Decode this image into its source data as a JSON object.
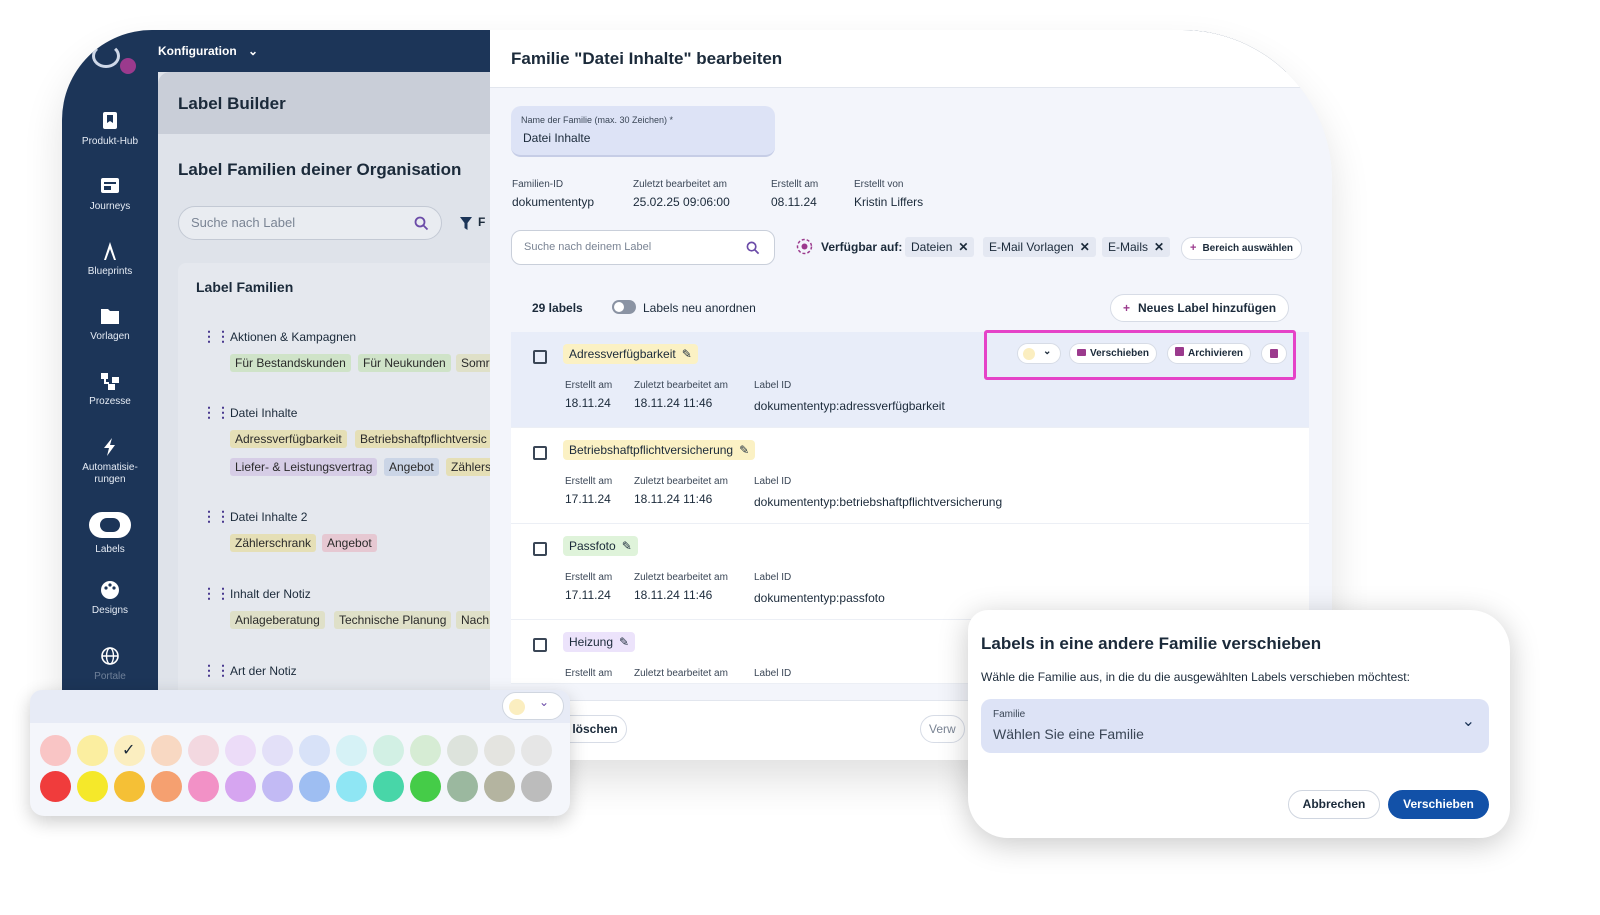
{
  "topbar": {
    "section": "Konfiguration"
  },
  "nav": {
    "items": [
      {
        "label": "Produkt-Hub",
        "icon": "bookmark-icon"
      },
      {
        "label": "Journeys",
        "icon": "journeys-icon"
      },
      {
        "label": "Blueprints",
        "icon": "compass-icon"
      },
      {
        "label": "Vorlagen",
        "icon": "folder-icon"
      },
      {
        "label": "Prozesse",
        "icon": "process-icon"
      },
      {
        "label": "Automatisie-",
        "label2": "rungen",
        "icon": "lightning-icon"
      },
      {
        "label": "Labels",
        "icon": "label-icon"
      },
      {
        "label": "Designs",
        "icon": "palette-icon"
      },
      {
        "label": "Portale",
        "icon": "globe-icon"
      }
    ]
  },
  "left": {
    "page_title": "Label Builder",
    "section_title": "Label Familien deiner Organisation",
    "search_placeholder": "Suche nach Label",
    "filter_label": "F",
    "families_header": "Label Familien",
    "families": [
      {
        "name": "Aktionen & Kampagnen",
        "chips": [
          "Für Bestandskunden",
          "Für Neukunden",
          "Somr"
        ]
      },
      {
        "name": "Datei Inhalte",
        "chips": [
          "Adressverfügbarkeit",
          "Betriebshaftpflichtversic",
          "Liefer- & Leistungsvertrag",
          "Angebot",
          "Zählers"
        ]
      },
      {
        "name": "Datei Inhalte 2",
        "chips": [
          "Zählerschrank",
          "Angebot"
        ]
      },
      {
        "name": "Inhalt der Notiz",
        "chips": [
          "Anlageberatung",
          "Technische Planung",
          "Nach"
        ]
      },
      {
        "name": "Art der Notiz",
        "chips": []
      }
    ]
  },
  "dialog": {
    "title": "Familie \"Datei Inhalte\" bearbeiten",
    "name_field": {
      "label": "Name der Familie (max. 30 Zeichen) *",
      "value": "Datei Inhalte"
    },
    "meta": [
      {
        "label": "Familien-ID",
        "value": "dokumententyp"
      },
      {
        "label": "Zuletzt bearbeitet am",
        "value": "25.02.25 09:06:00"
      },
      {
        "label": "Erstellt am",
        "value": "08.11.24"
      },
      {
        "label": "Erstellt von",
        "value": "Kristin Liffers"
      }
    ],
    "search_placeholder": "Suche nach deinem Label",
    "available_label": "Verfügbar auf:",
    "available_tags": [
      "Dateien",
      "E-Mail Vorlagen",
      "E-Mails"
    ],
    "select_area": "Bereich auswählen",
    "count_label": "29 labels",
    "reorder_label": "Labels neu anordnen",
    "add_label": "Neues Label hinzufügen",
    "col_created": "Erstellt am",
    "col_edited": "Zuletzt bearbeitet am",
    "col_id": "Label ID",
    "actions": {
      "move": "Verschieben",
      "archive": "Archivieren"
    },
    "labels": [
      {
        "name": "Adressverfügbarkeit",
        "created": "18.11.24",
        "edited": "18.11.24 11:46",
        "id": "dokumententyp:adressverfügbarkeit",
        "color": "#fbf1c4"
      },
      {
        "name": "Betriebshaftpflichtversicherung",
        "created": "17.11.24",
        "edited": "18.11.24 11:46",
        "id": "dokumententyp:betriebshaftpflichtversicherung",
        "color": "#fbf1c4"
      },
      {
        "name": "Passfoto",
        "created": "17.11.24",
        "edited": "18.11.24 11:46",
        "id": "dokumententyp:passfoto",
        "color": "#dff3da"
      },
      {
        "name": "Heizung",
        "created": "",
        "edited": "",
        "id": "",
        "color": "#ece3fb"
      }
    ],
    "footer": {
      "delete": "ie löschen",
      "discard": "Verw"
    }
  },
  "modal": {
    "title": "Labels in eine andere Familie verschieben",
    "text": "Wähle die Familie aus, in die du die ausgewählten Labels verschieben möchtest:",
    "field_label": "Familie",
    "field_placeholder": "Wählen Sie eine Familie",
    "cancel": "Abbrechen",
    "confirm": "Verschieben"
  },
  "palette": {
    "selected": "#fbeec0",
    "row1": [
      "#f9c5c5",
      "#fbeea0",
      "#fbeec0",
      "#f8d8c2",
      "#f3d8e0",
      "#ecdcf8",
      "#e3e0f8",
      "#d8e2f8",
      "#d6f2f6",
      "#d2f0e4",
      "#d6ecd4",
      "#dde3dc",
      "#e4e4e0",
      "#e6e6e6"
    ],
    "row2": [
      "#f03c3c",
      "#f5e82a",
      "#f5c036",
      "#f5a070",
      "#f291c6",
      "#d6a5f0",
      "#c2baf4",
      "#9ebef2",
      "#8fe6f4",
      "#48d6a8",
      "#45cc48",
      "#9bb89f",
      "#b4b4a0",
      "#bcbcbc"
    ]
  }
}
